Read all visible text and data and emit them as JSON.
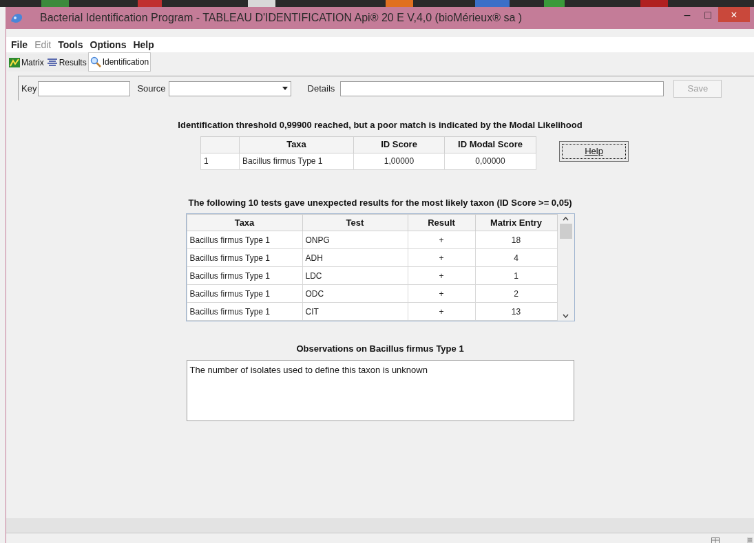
{
  "window": {
    "title": "Bacterial Identification Program - TABLEAU D'IDENTIFICATION Api® 20 E V,4,0  (bioMérieux® sa )",
    "controls": [
      "–",
      "□",
      "×"
    ]
  },
  "menu": [
    {
      "label": "File",
      "disabled": false
    },
    {
      "label": "Edit",
      "disabled": true
    },
    {
      "label": "Tools",
      "disabled": false
    },
    {
      "label": "Options",
      "disabled": false
    },
    {
      "label": "Help",
      "disabled": false
    }
  ],
  "tabs": [
    {
      "label": "Matrix",
      "kind": "matrix",
      "selected": false
    },
    {
      "label": "Results",
      "kind": "results",
      "selected": false
    },
    {
      "label": "Identification",
      "kind": "search",
      "selected": true
    }
  ],
  "form": {
    "key": {
      "label": "Key"
    },
    "source": {
      "label": "Source"
    },
    "details": {
      "label": "Details"
    },
    "save": {
      "label": "Save",
      "disabled": true
    }
  },
  "id_heading": "Identification threshold 0,99900 reached, but a poor match is indicated by the Modal Likelihood",
  "id_table": {
    "columns": [
      "",
      "Taxa",
      "ID Score",
      "ID Modal Score"
    ],
    "rows": [
      [
        "1",
        "Bacillus firmus Type 1",
        "1,00000",
        "0,00000"
      ]
    ]
  },
  "help_button": "Help",
  "tests_heading": "The following 10 tests gave unexpected results for the most likely taxon (ID Score >= 0,05)",
  "tests_table": {
    "columns": [
      "Taxa",
      "Test",
      "Result",
      "Matrix Entry"
    ],
    "rows": [
      [
        "Bacillus firmus Type 1",
        "ONPG",
        "+",
        "18"
      ],
      [
        "Bacillus firmus Type 1",
        "ADH",
        "+",
        "4"
      ],
      [
        "Bacillus firmus Type 1",
        "LDC",
        "+",
        "1"
      ],
      [
        "Bacillus firmus Type 1",
        "ODC",
        "+",
        "2"
      ],
      [
        "Bacillus firmus Type 1",
        "CIT",
        "+",
        "13"
      ]
    ]
  },
  "observations": {
    "heading": "Observations on Bacillus firmus Type 1",
    "text": "The number of isolates used to define this taxon is unknown"
  }
}
